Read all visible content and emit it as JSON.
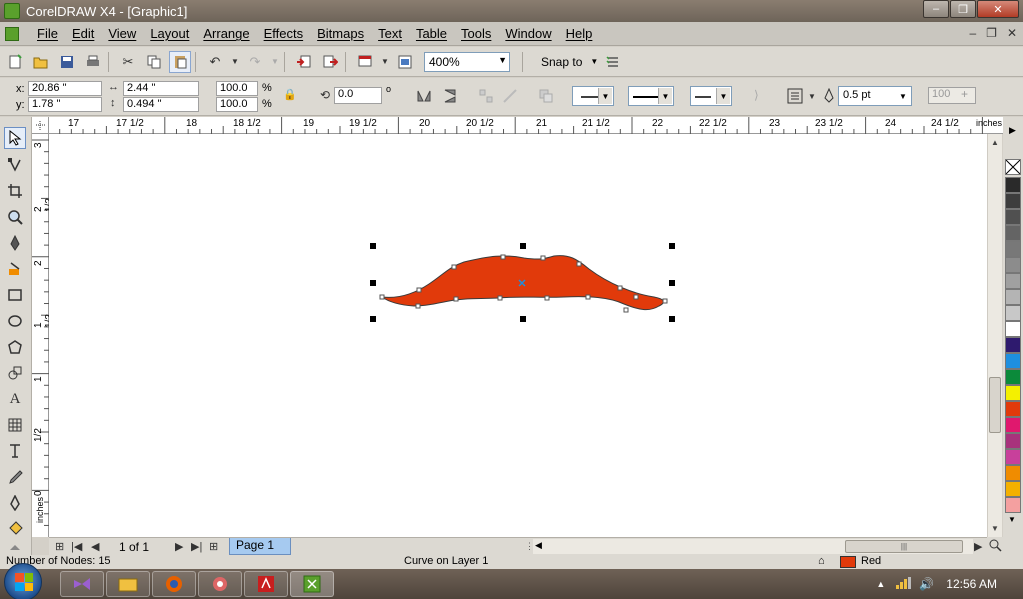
{
  "window": {
    "title": "CorelDRAW X4 - [Graphic1]",
    "controls": {
      "minimize": "–",
      "maximize": "❐",
      "close": "✕"
    }
  },
  "menu": {
    "items": [
      "File",
      "Edit",
      "View",
      "Layout",
      "Arrange",
      "Effects",
      "Bitmaps",
      "Text",
      "Table",
      "Tools",
      "Window",
      "Help"
    ],
    "doc_controls": {
      "minimize": "–",
      "restore": "❐",
      "close": "✕"
    }
  },
  "toolbar": {
    "zoom": "400%",
    "snap_to": "Snap to"
  },
  "properties": {
    "x_label": "x:",
    "x_value": "20.86 \"",
    "y_label": "y:",
    "y_value": "1.78 \"",
    "width_value": "2.44 \"",
    "height_value": "0.494 \"",
    "scale_x": "100.0",
    "scale_y": "100.0",
    "pct_x": "%",
    "pct_y": "%",
    "rotation": "0.0",
    "degree": "o",
    "outline_width": "0.5 pt",
    "transparency": "100"
  },
  "ruler_h": {
    "units": "inches",
    "labels": [
      "17",
      "17 1/2",
      "18",
      "18 1/2",
      "19",
      "19 1/2",
      "20",
      "20 1/2",
      "21",
      "21 1/2",
      "22",
      "22 1/2",
      "23",
      "23 1/2",
      "24",
      "24 1/2"
    ]
  },
  "ruler_v": {
    "units": "inches",
    "labels": [
      "3",
      "2 1/2",
      "2",
      "1 1/2",
      "1",
      "1/2",
      "0"
    ]
  },
  "document": {
    "shape_name": "mustache curve",
    "fill_color": "#e13a0b",
    "outline_color": "#3a3a3a"
  },
  "palette": {
    "colors": [
      "#2a2a2a",
      "#3d3d3d",
      "#505050",
      "#646464",
      "#787878",
      "#8c8c8c",
      "#a0a0a0",
      "#b4b4b4",
      "#c8c8c8",
      "#ffffff",
      "#2e1a6e",
      "#1e8fdf",
      "#0b8a3a",
      "#f4f000",
      "#e13a0b",
      "#e0186e",
      "#a8327c",
      "#c8409b",
      "#f08c00",
      "#f4b000",
      "#f4a0a0"
    ]
  },
  "page_nav": {
    "counter": "1 of 1",
    "page_tab": "Page 1"
  },
  "status": {
    "nodes": "Number of Nodes: 15",
    "layer": "Curve on Layer 1",
    "fill_name": "Red"
  },
  "taskbar": {
    "clock": "12:56 AM"
  }
}
